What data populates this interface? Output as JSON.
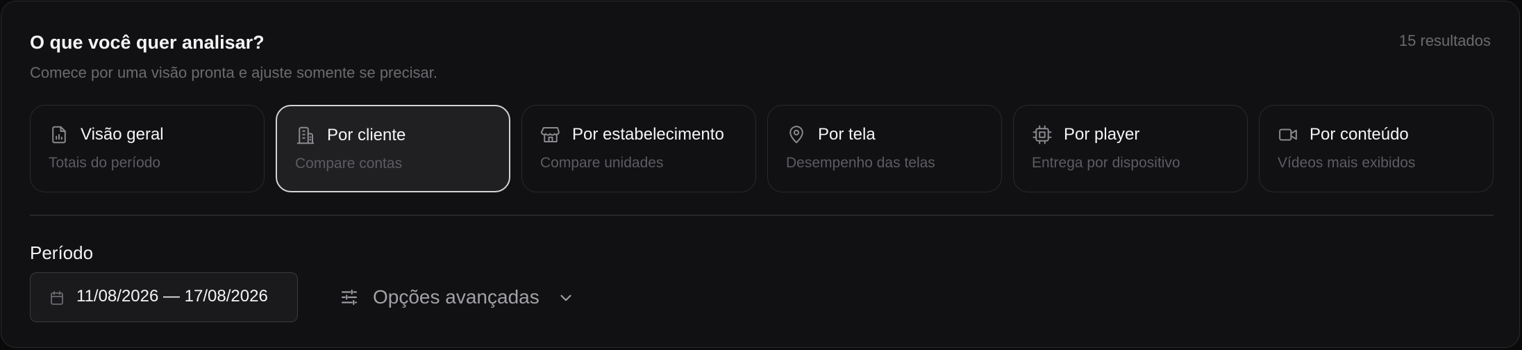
{
  "header": {
    "title": "O que você quer analisar?",
    "subtitle": "Comece por uma visão pronta e ajuste somente se precisar.",
    "results": "15 resultados"
  },
  "views": [
    {
      "label": "Visão geral",
      "desc": "Totais do período",
      "icon": "chart-file-icon",
      "selected": false
    },
    {
      "label": "Por cliente",
      "desc": "Compare contas",
      "icon": "building-icon",
      "selected": true
    },
    {
      "label": "Por estabelecimento",
      "desc": "Compare unidades",
      "icon": "store-icon",
      "selected": false
    },
    {
      "label": "Por tela",
      "desc": "Desempenho das telas",
      "icon": "map-pin-icon",
      "selected": false
    },
    {
      "label": "Por player",
      "desc": "Entrega por dispositivo",
      "icon": "cpu-icon",
      "selected": false
    },
    {
      "label": "Por conteúdo",
      "desc": "Vídeos mais exibidos",
      "icon": "video-icon",
      "selected": false
    }
  ],
  "period": {
    "label": "Período",
    "date_range": "11/08/2026 — 17/08/2026",
    "icon": "calendar-icon"
  },
  "advanced": {
    "label": "Opções avançadas",
    "icon": "sliders-icon",
    "chevron": "chevron-down-icon"
  },
  "colors": {
    "panel_bg": "#111113",
    "selected_bg": "#202023",
    "selected_border": "#d4d4d8",
    "text_primary": "#f4f4f5",
    "text_muted": "#6b6b70"
  }
}
